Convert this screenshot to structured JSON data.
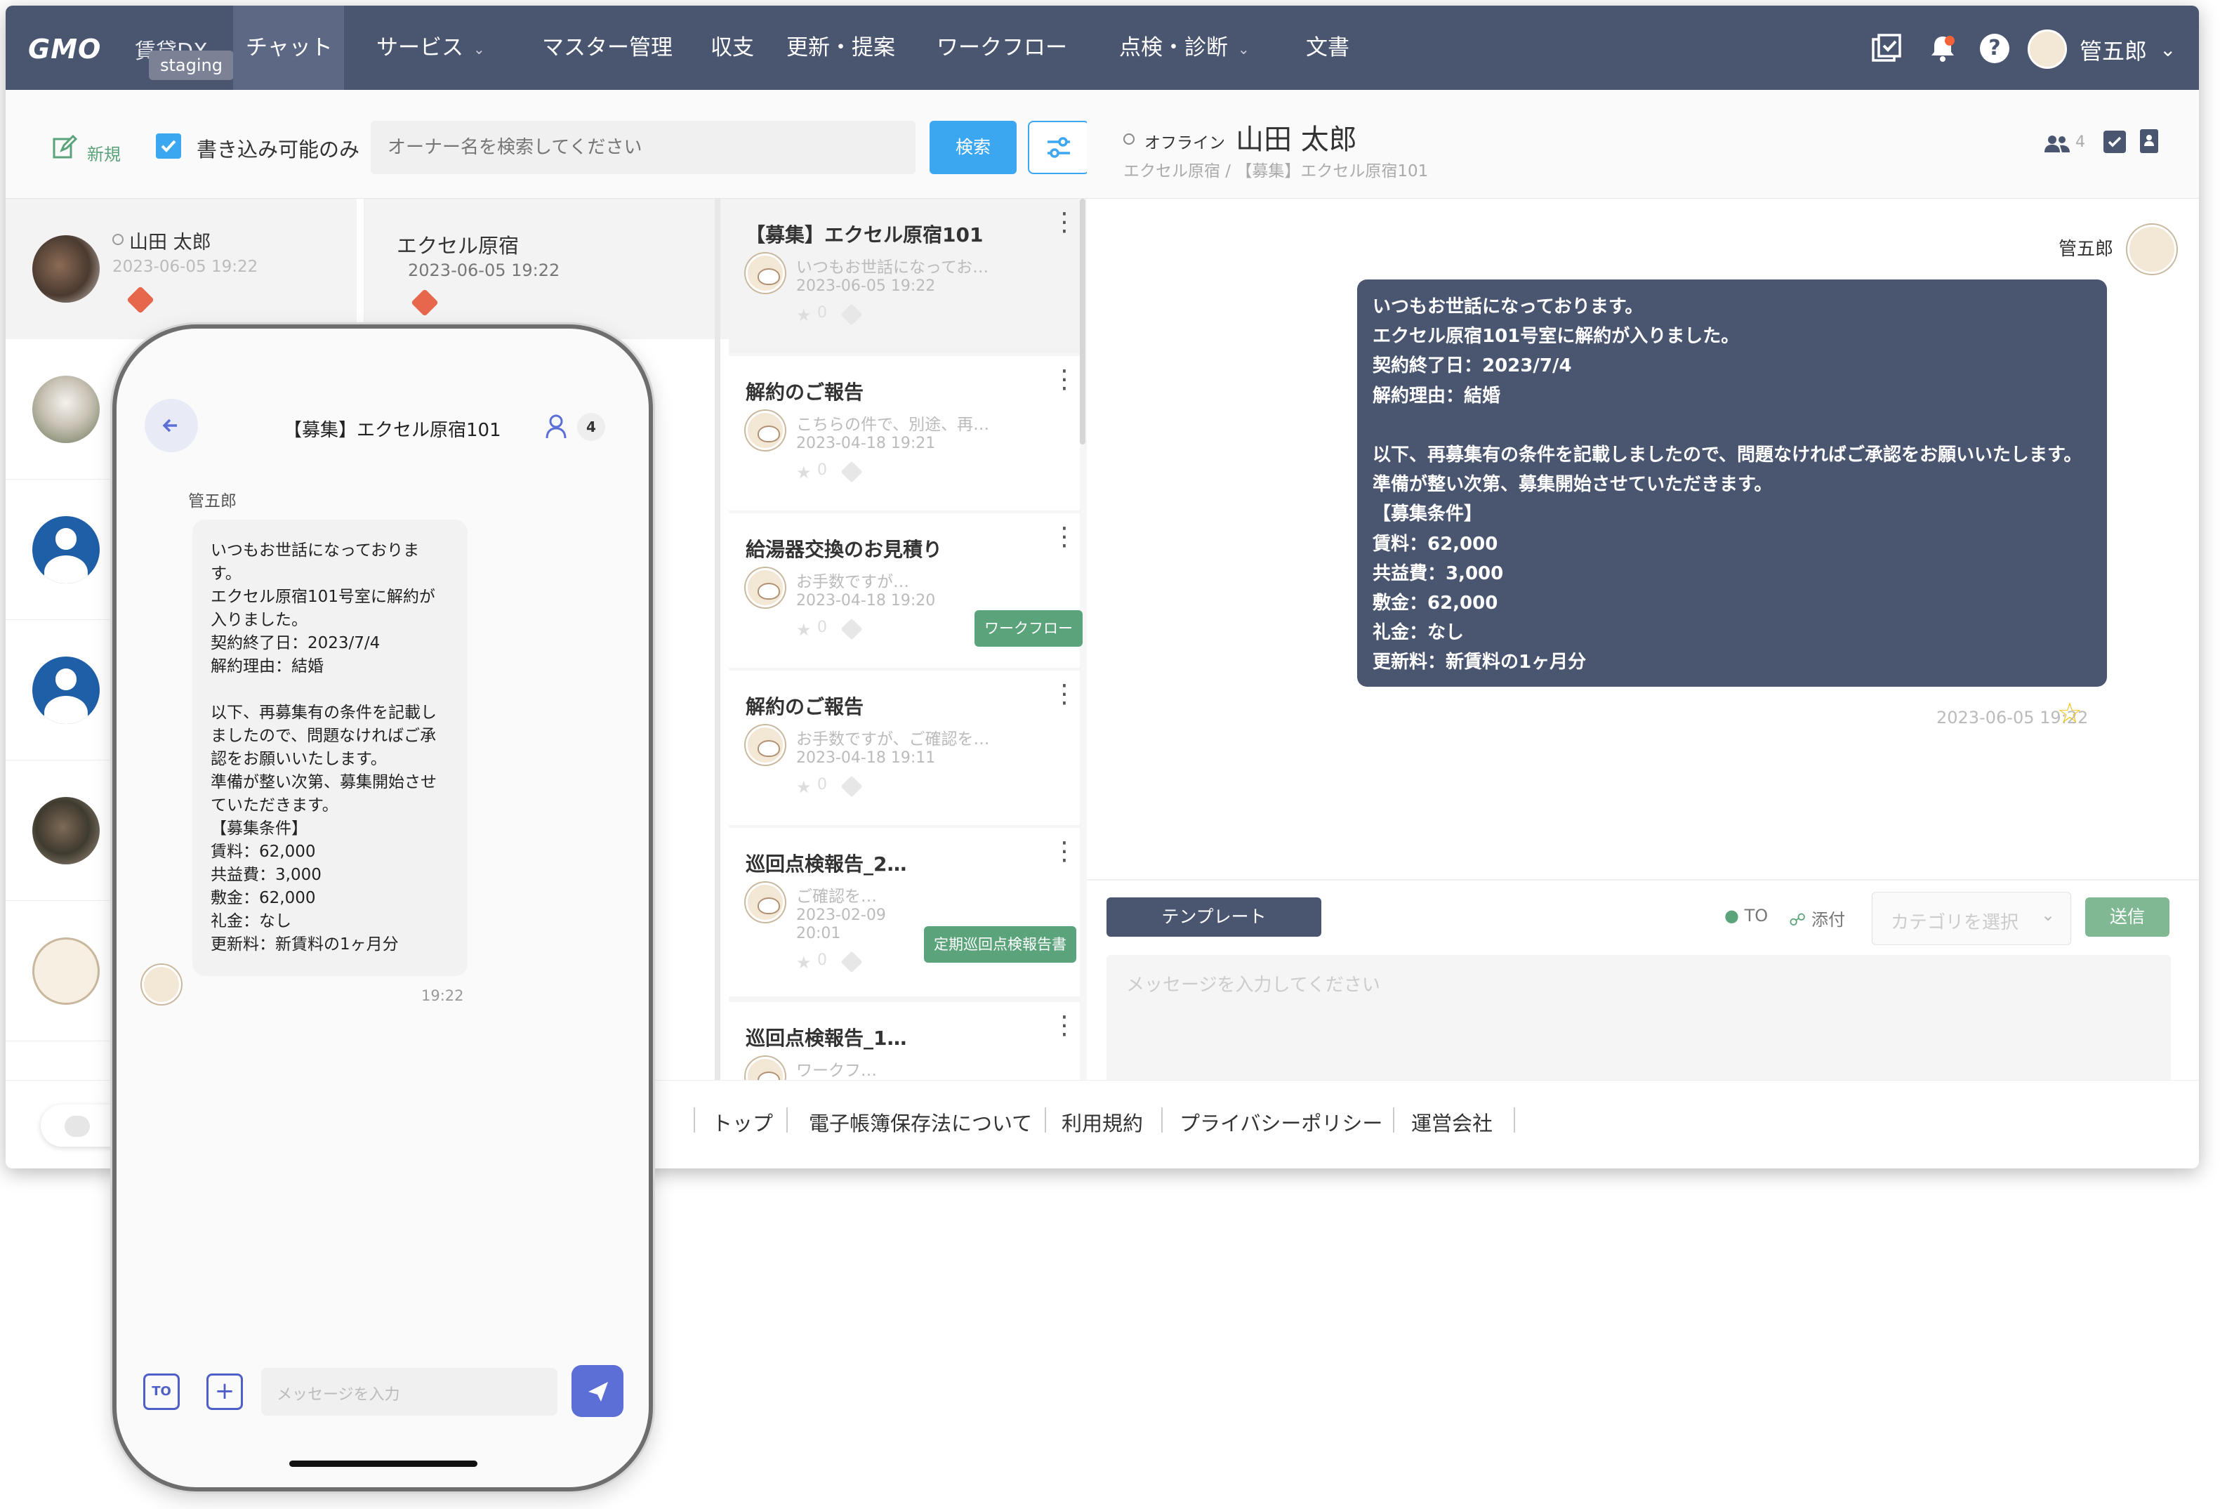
{
  "brand": {
    "logo": "GMO",
    "product": "賃貸DX",
    "env": "staging"
  },
  "nav": {
    "items": [
      {
        "label": "チャット",
        "active": true
      },
      {
        "label": "サービス",
        "dropdown": true
      },
      {
        "label": "マスター管理"
      },
      {
        "label": "収支"
      },
      {
        "label": "更新・提案"
      },
      {
        "label": "ワークフロー"
      },
      {
        "label": "点検・診断",
        "dropdown": true
      },
      {
        "label": "文書"
      }
    ],
    "user_name": "管五郎"
  },
  "toolbar": {
    "new_label": "新規",
    "writable_only_label": "書き込み可能のみ",
    "search_placeholder": "オーナー名を検索してください",
    "search_button": "検索"
  },
  "owners": [
    {
      "name": "山田 太郎",
      "date": "2023-06-05 19:22",
      "selected": true
    }
  ],
  "property": {
    "name": "エクセル原宿",
    "date": "2023-06-05 19:22"
  },
  "threads": [
    {
      "title": "【募集】エクセル原宿101",
      "preview": "いつもお世話になってお…",
      "date": "2023-06-05 19:22",
      "stars": "0",
      "tag": ""
    },
    {
      "title": "解約のご報告",
      "preview": "こちらの件で、別途、再…",
      "date": "2023-04-18 19:21",
      "stars": "0",
      "tag": ""
    },
    {
      "title": "給湯器交換のお見積り",
      "preview": "お手数ですが…",
      "date": "2023-04-18 19:20",
      "stars": "0",
      "tag": "ワークフロー"
    },
    {
      "title": "解約のご報告",
      "preview": "お手数ですが、ご確認を…",
      "date": "2023-04-18 19:11",
      "stars": "0",
      "tag": ""
    },
    {
      "title": "巡回点検報告_2…",
      "preview": "ご確認を…",
      "date_line1": "2023-02-09",
      "date_line2": "20:01",
      "stars": "0",
      "tag": "定期巡回点検報告書"
    },
    {
      "title": "巡回点検報告_1…",
      "preview": "ワークフ…"
    }
  ],
  "chat": {
    "status": "オフライン",
    "title": "山田 太郎",
    "breadcrumb": "エクセル原宿 / 【募集】エクセル原宿101",
    "member_count": "4",
    "sender": "管五郎",
    "message_lines": [
      "いつもお世話になっております。",
      "エクセル原宿101号室に解約が入りました。",
      "契約終了日：2023/7/4",
      "解約理由：結婚",
      "",
      "以下、再募集有の条件を記載しましたので、問題なければご承認をお願いいたします。",
      "準備が整い次第、募集開始させていただきます。",
      "【募集条件】",
      "賃料：62,000",
      "共益費：3,000",
      "敷金：62,000",
      "礼金：なし",
      "更新料：新賃料の1ヶ月分"
    ],
    "timestamp": "2023-06-05 19:22",
    "template_button": "テンプレート",
    "to_label": "TO",
    "attach_label": "添付",
    "category_placeholder": "カテゴリを選択",
    "send_button": "送信",
    "input_placeholder": "メッセージを入力してください"
  },
  "footer": {
    "links": [
      "トップ",
      "電子帳簿保存法について",
      "利用規約",
      "プライバシーポリシー",
      "運営会社"
    ]
  },
  "phone": {
    "title": "【募集】エクセル原宿101",
    "member_count": "4",
    "sender": "管五郎",
    "message_lines": [
      "いつもお世話になっておりま",
      "す。",
      "エクセル原宿101号室に解約が",
      "入りました。",
      "契約終了日：2023/7/4",
      "解約理由：結婚",
      "",
      "以下、再募集有の条件を記載し",
      "ましたので、問題なければご承",
      "認をお願いいたします。",
      "準備が整い次第、募集開始させ",
      "ていただきます。",
      "【募集条件】",
      "賃料：62,000",
      "共益費：3,000",
      "敷金：62,000",
      "礼金：なし",
      "更新料：新賃料の1ヶ月分"
    ],
    "time": "19:22",
    "to_label": "TO",
    "input_placeholder": "メッセージを入力"
  },
  "colors": {
    "nav_bg": "#4a5570",
    "accent_blue": "#3ba7f0",
    "tag_green": "#5ba37a",
    "send_blue": "#5b6fd6",
    "star_yellow": "#f0c419"
  }
}
